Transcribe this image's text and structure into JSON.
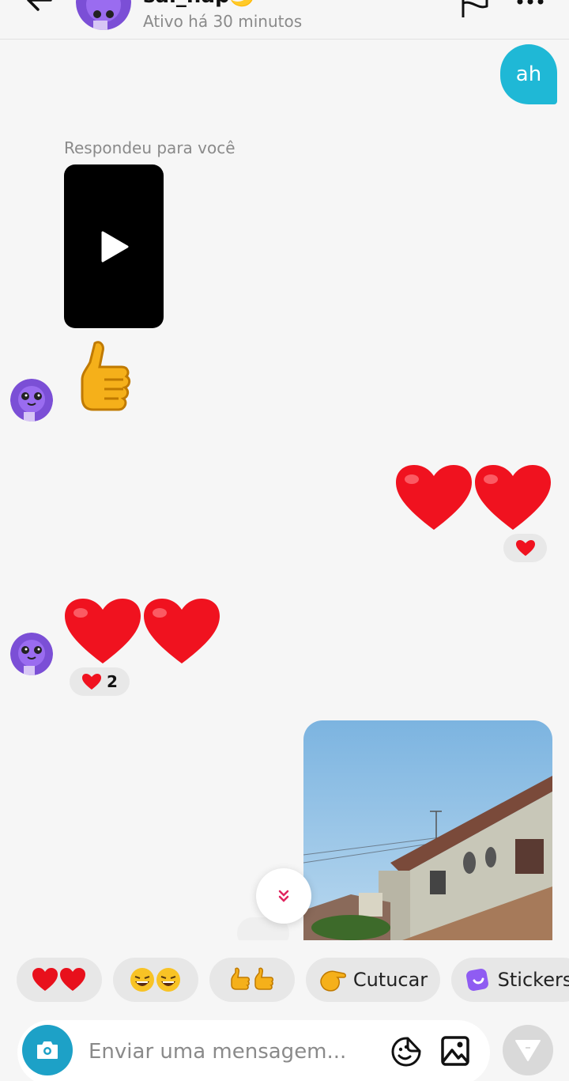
{
  "header": {
    "name": "sal_hap🌙",
    "status": "Ativo há 30 minutos"
  },
  "messages": {
    "sent_text": "ah",
    "reply_label": "Respondeu para você",
    "thumbs_emoji": "👍",
    "sent_hearts": "❤️❤️",
    "sent_hearts_reaction": "❤️",
    "recv_hearts": "❤️❤️",
    "recv_hearts_reaction_emoji": "❤️",
    "recv_hearts_reaction_count": "2"
  },
  "quick_replies": [
    {
      "emoji": "❤️❤️",
      "label": ""
    },
    {
      "emoji": "😂😂",
      "label": ""
    },
    {
      "emoji": "👍👍",
      "label": ""
    },
    {
      "emoji": "👏",
      "label": "Cutucar"
    },
    {
      "emoji": "",
      "label": "Stickers"
    }
  ],
  "composer": {
    "placeholder": "Enviar uma mensagem..."
  },
  "colors": {
    "accent": "#1fb8d6",
    "camera": "#1da1c7",
    "send_disabled": "#d9d9d9",
    "background": "#f6f6f6",
    "chip": "#e7e7e7",
    "avatar": "#7b4fd6"
  },
  "icons": [
    "back-arrow-icon",
    "flag-icon",
    "more-icon",
    "play-icon",
    "chevron-double-down-icon",
    "camera-icon",
    "sticker-icon",
    "image-icon",
    "send-icon",
    "stickers-icon"
  ]
}
